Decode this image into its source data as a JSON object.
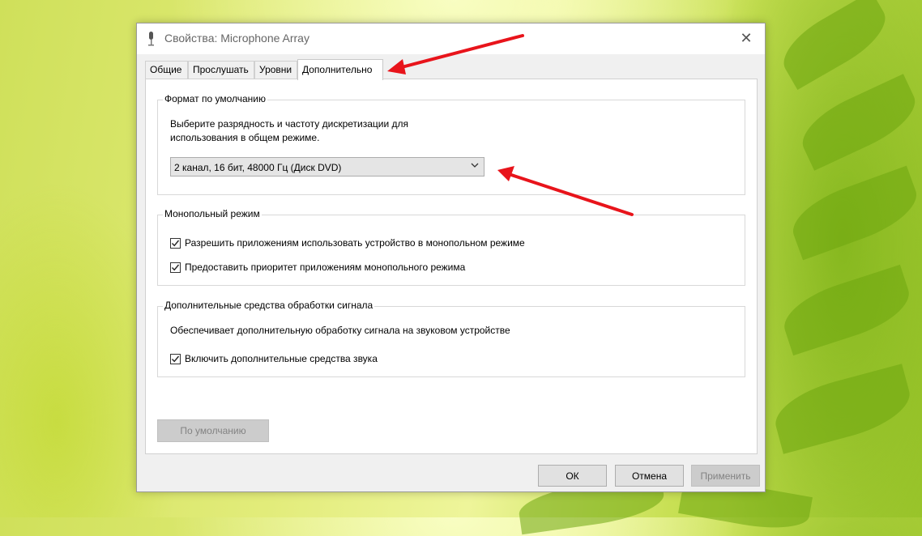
{
  "window": {
    "title": "Свойства: Microphone Array",
    "close_symbol": "✕"
  },
  "tabs": [
    {
      "label": "Общие",
      "active": false
    },
    {
      "label": "Прослушать",
      "active": false
    },
    {
      "label": "Уровни",
      "active": false
    },
    {
      "label": "Дополнительно",
      "active": true
    }
  ],
  "default_format": {
    "legend": "Формат по умолчанию",
    "description_line1": "Выберите разрядность и частоту дискретизации для",
    "description_line2": "использования в общем режиме.",
    "selected_value": "2 канал, 16 бит, 48000 Гц (Диск DVD)"
  },
  "exclusive_mode": {
    "legend": "Монопольный режим",
    "options": [
      {
        "label": "Разрешить приложениям использовать устройство в монопольном режиме",
        "checked": true
      },
      {
        "label": "Предоставить приоритет приложениям монопольного режима",
        "checked": true
      }
    ]
  },
  "signal_enhancements": {
    "legend": "Дополнительные средства обработки сигнала",
    "description": "Обеспечивает дополнительную обработку сигнала на звуковом устройстве",
    "option": {
      "label": "Включить дополнительные средства звука",
      "checked": true
    }
  },
  "buttons": {
    "restore_defaults": "По умолчанию",
    "ok": "ОК",
    "cancel": "Отмена",
    "apply": "Применить"
  },
  "annotation": {
    "arrow_color": "#e8141b"
  },
  "icons": {
    "title": "microphone-icon",
    "close": "close-icon",
    "dropdown": "chevron-down-icon",
    "check": "checkmark-icon"
  }
}
